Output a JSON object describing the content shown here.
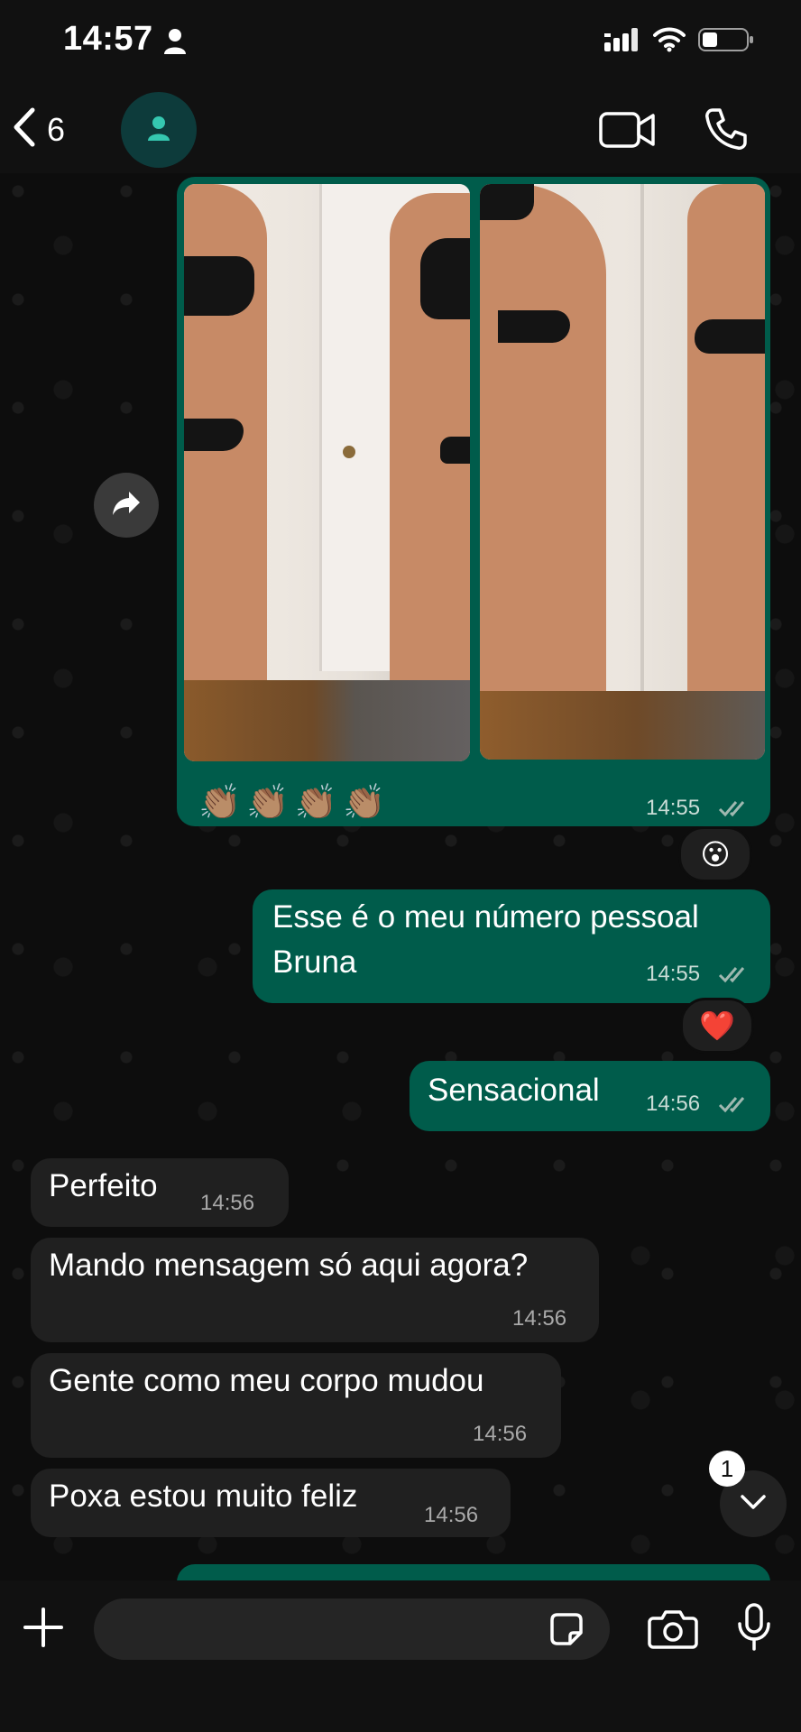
{
  "status_bar": {
    "time": "14:57"
  },
  "header": {
    "back_count": "6"
  },
  "messages": [
    {
      "id": "media",
      "type": "outgoing",
      "caption": "👏🏽👏🏽👏🏽👏🏽",
      "time": "14:55",
      "status": "read",
      "reaction": "😮"
    },
    {
      "id": "m2",
      "type": "outgoing",
      "text_line1": "Esse é o meu número pessoal",
      "text_line2": "Bruna",
      "time": "14:55",
      "status": "read",
      "reaction": "❤️"
    },
    {
      "id": "m3",
      "type": "outgoing",
      "text": "Sensacional",
      "time": "14:56",
      "status": "read"
    },
    {
      "id": "m4",
      "type": "incoming",
      "text": "Perfeito",
      "time": "14:56"
    },
    {
      "id": "m5",
      "type": "incoming",
      "text": "Mando mensagem só aqui agora?",
      "time": "14:56"
    },
    {
      "id": "m6",
      "type": "incoming",
      "text": "Gente como meu corpo mudou",
      "time": "14:56"
    },
    {
      "id": "m7",
      "type": "incoming",
      "text": "Poxa estou muito feliz",
      "time": "14:56"
    }
  ],
  "scroll_badge": "1",
  "composer": {
    "placeholder": ""
  },
  "colors": {
    "outgoing_bubble": "#005c4b",
    "incoming_bubble": "#202020",
    "read_ticks": "#53bdeb",
    "background": "#0b0b0b"
  },
  "icons": [
    "person-icon",
    "signal-icon",
    "wifi-icon",
    "battery-icon",
    "back-chevron-icon",
    "avatar-person-icon",
    "video-call-icon",
    "phone-icon",
    "forward-icon",
    "chevron-down-icon",
    "plus-icon",
    "sticker-icon",
    "camera-icon",
    "microphone-icon"
  ]
}
